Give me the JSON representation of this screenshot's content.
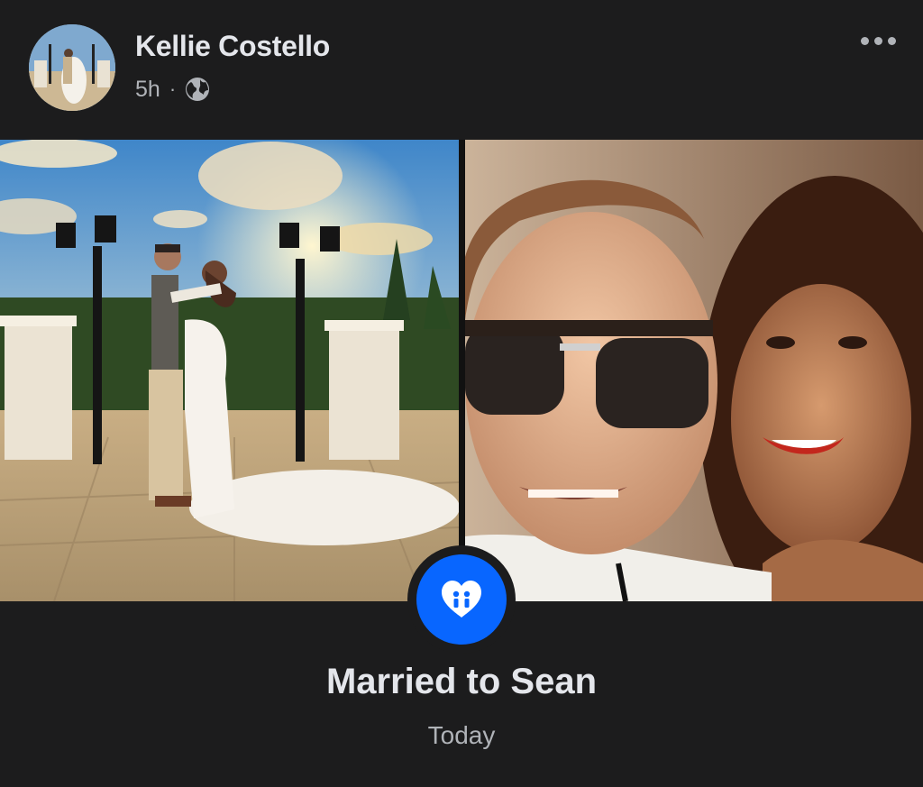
{
  "post": {
    "author": "Kellie Costello",
    "time": "5h",
    "separator": "·",
    "audience_icon": "globe-icon",
    "more_icon": "more-horizontal-icon"
  },
  "life_event": {
    "icon": "heart-couple-icon",
    "title": "Married to Sean",
    "date": "Today",
    "accent_color": "#0866ff"
  },
  "photos": [
    {
      "subject": "wedding-photo"
    },
    {
      "subject": "selfie-photo"
    }
  ]
}
